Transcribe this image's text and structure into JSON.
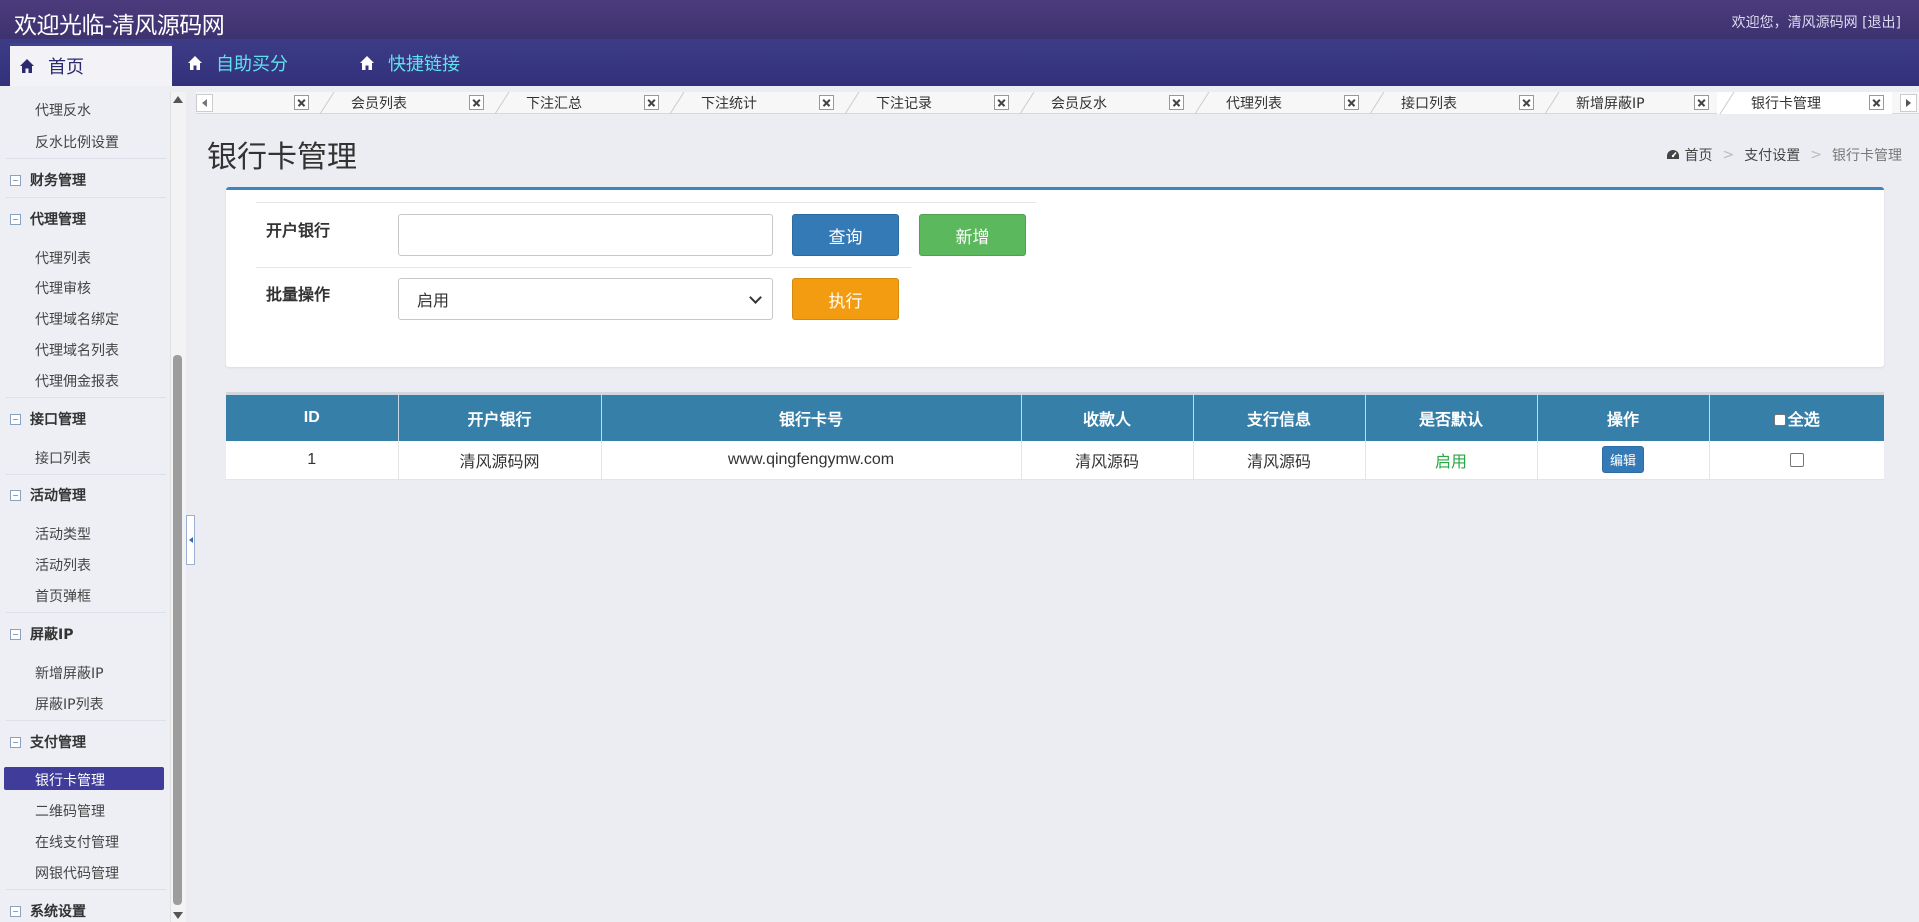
{
  "app": {
    "title": "欢迎光临-清风源码网",
    "welcome_text": "欢迎您，清风源码网",
    "logout": "[退出]"
  },
  "nav": {
    "home": "首页",
    "items": [
      "自助买分",
      "快捷链接"
    ]
  },
  "sidebar": {
    "items": [
      {
        "type": "item",
        "label": "代理反水"
      },
      {
        "type": "item",
        "label": "反水比例设置"
      },
      {
        "type": "group",
        "label": "财务管理"
      },
      {
        "type": "group",
        "label": "代理管理"
      },
      {
        "type": "item",
        "label": "代理列表"
      },
      {
        "type": "item",
        "label": "代理审核"
      },
      {
        "type": "item",
        "label": "代理域名绑定"
      },
      {
        "type": "item",
        "label": "代理域名列表"
      },
      {
        "type": "item",
        "label": "代理佣金报表"
      },
      {
        "type": "group",
        "label": "接口管理"
      },
      {
        "type": "item",
        "label": "接口列表"
      },
      {
        "type": "group",
        "label": "活动管理"
      },
      {
        "type": "item",
        "label": "活动类型"
      },
      {
        "type": "item",
        "label": "活动列表"
      },
      {
        "type": "item",
        "label": "首页弹框"
      },
      {
        "type": "group",
        "label": "屏蔽IP"
      },
      {
        "type": "item",
        "label": "新增屏蔽IP"
      },
      {
        "type": "item",
        "label": "屏蔽IP列表"
      },
      {
        "type": "group",
        "label": "支付管理"
      },
      {
        "type": "item",
        "label": "银行卡管理",
        "active": true
      },
      {
        "type": "item",
        "label": "二维码管理"
      },
      {
        "type": "item",
        "label": "在线支付管理"
      },
      {
        "type": "item",
        "label": "网银代码管理"
      },
      {
        "type": "group",
        "label": "系统设置"
      }
    ]
  },
  "tabs": [
    {
      "label": ""
    },
    {
      "label": "会员列表"
    },
    {
      "label": "下注汇总"
    },
    {
      "label": "下注统计"
    },
    {
      "label": "下注记录"
    },
    {
      "label": "会员反水"
    },
    {
      "label": "代理列表"
    },
    {
      "label": "接口列表"
    },
    {
      "label": "新增屏蔽IP"
    },
    {
      "label": "银行卡管理",
      "active": true
    }
  ],
  "page": {
    "title": "银行卡管理",
    "breadcrumb": [
      "首页",
      "支付设置",
      "银行卡管理"
    ]
  },
  "filter": {
    "bank_label": "开户银行",
    "bank_value": "",
    "query_button": "查询",
    "add_button": "新增",
    "batch_label": "批量操作",
    "batch_selected": "启用",
    "execute_button": "执行"
  },
  "table": {
    "headers": [
      "ID",
      "开户银行",
      "银行卡号",
      "收款人",
      "支行信息",
      "是否默认",
      "操作",
      "全选"
    ],
    "rows": [
      {
        "id": "1",
        "bank": "清风源码网",
        "card_no": "www.qingfengymw.com",
        "payee": "清风源码",
        "branch": "清风源码",
        "default": "启用",
        "action": "编辑"
      }
    ]
  },
  "colors": {
    "topbar": "#3d3270",
    "navbar": "#32307a",
    "nav_text": "#5ee3ee",
    "table_header": "#367fa9",
    "query": "#337ab7",
    "add": "#5cb85c",
    "execute": "#f39c12",
    "status_on": "#28a745"
  }
}
